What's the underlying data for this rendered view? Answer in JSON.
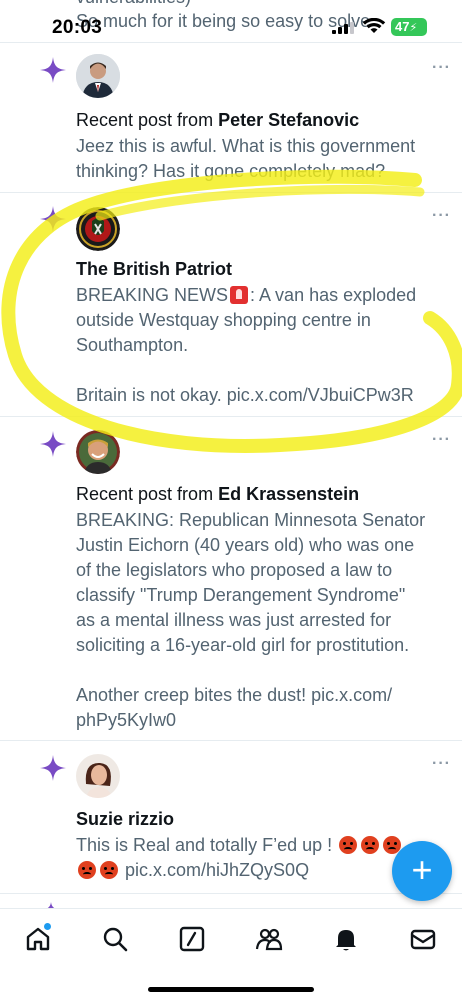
{
  "status_bar": {
    "time": "20:03",
    "battery": "47",
    "cut_text_top": "vulnerabilities)",
    "cut_text_bottom": "So much for it being so easy to solve"
  },
  "feed": [
    {
      "prefix": "Recent post from ",
      "author": "Peter Stefanovic",
      "text": "Jeez this is awful. What is this government\nthinking? Has it gone completely mad?",
      "more_label": "···"
    },
    {
      "prefix": "",
      "author": "The British Patriot",
      "text_a": "BREAKING NEWS",
      "text_b": ": A van has exploded\noutside Westquay shopping centre in\nSouthampton.\n\nBritain is not okay. pic.x.com/VJbuiCPw3R",
      "more_label": "···"
    },
    {
      "prefix": "Recent post from ",
      "author": "Ed Krassenstein",
      "text": "BREAKING: Republican Minnesota Senator\nJustin Eichorn (40 years old) who was one\nof the legislators who proposed a law to\nclassify \"Trump Derangement Syndrome\"\nas a mental illness was just arrested for\nsoliciting a 16-year-old girl for prostitution.\n\nAnother creep bites the dust! pic.x.com/\nphPy5KyIw0",
      "more_label": "···"
    },
    {
      "prefix": "",
      "author": "Suzie rizzio",
      "text_a": "This is Real and totally F’ed up !",
      "text_b": "pic.x.com/hiJhZQyS0Q",
      "more_label": "···"
    }
  ],
  "fab": {
    "label": "+"
  },
  "tabs": [
    "home-icon",
    "search-icon",
    "grok-icon",
    "communities-icon",
    "notifications-icon",
    "messages-icon"
  ],
  "colors": {
    "accent": "#1d9bf0",
    "sparkle": "#794bc4",
    "highlighter": "#f3ee16",
    "text_secondary": "#536471"
  }
}
